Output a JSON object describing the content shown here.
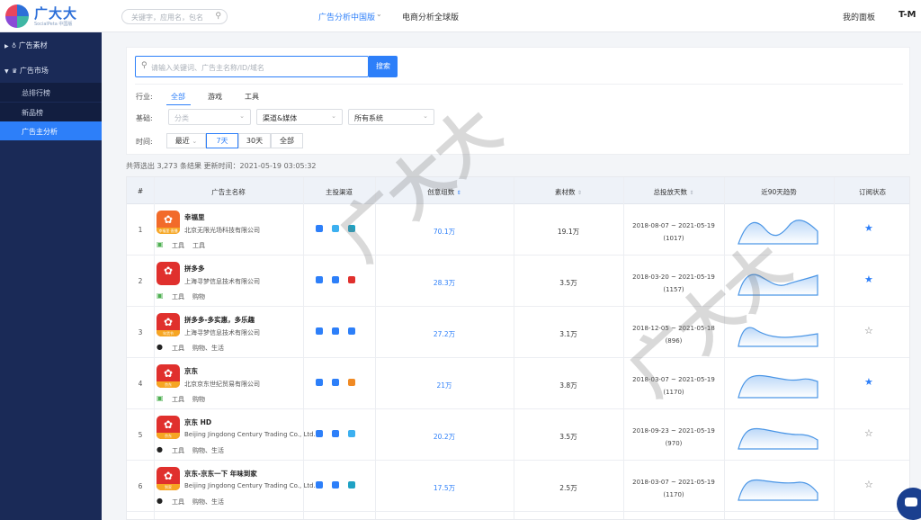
{
  "header": {
    "brand": "广大大",
    "brand_sub": "SocialPeta 中国版",
    "search_placeholder": "关键字，应用名，包名",
    "nav_primary": "广告分析中国版",
    "nav_secondary": "电商分析全球版",
    "my_panel": "我的面板",
    "user_logo": "T-M"
  },
  "sidebar": {
    "sections": [
      {
        "label": "广告素材"
      },
      {
        "label": "广告市场"
      }
    ],
    "subitems": [
      {
        "label": "总排行榜"
      },
      {
        "label": "新品榜"
      },
      {
        "label": "广告主分析",
        "active": true
      }
    ]
  },
  "search": {
    "placeholder": "请输入关键词、广告主名称/ID/域名",
    "button": "搜索"
  },
  "filters": {
    "industry_label": "行业:",
    "industry_options": [
      "全部",
      "游戏",
      "工具"
    ],
    "basic_label": "基础:",
    "category_placeholder": "分类",
    "channel_select": "渠道&媒体",
    "system_select": "所有系统",
    "time_label": "时间:",
    "time_options": [
      "最近",
      "7天",
      "30天",
      "全部"
    ]
  },
  "summary": "共筛选出 3,273 条结果 更新时间：2021-05-19 03:05:32",
  "table": {
    "headers": [
      "#",
      "广告主名称",
      "主投渠道",
      "创意组数",
      "素材数",
      "总投放天数",
      "近90天趋势",
      "订阅状态"
    ],
    "rows": [
      {
        "idx": "1",
        "name": "幸福里",
        "company": "北京无限光场科技有限公司",
        "platform": "android",
        "tags": [
          "工具",
          "工具"
        ],
        "creatives": "70.1万",
        "materials": "19.1万",
        "date_range": "2018-08-07 ~ 2021-05-19",
        "days": "(1017)",
        "subscribed": true,
        "icon": "orange",
        "ribbon": "幸福里·直播"
      },
      {
        "idx": "2",
        "name": "拼多多",
        "company": "上海寻梦信息技术有限公司",
        "platform": "android",
        "tags": [
          "工具",
          "购物"
        ],
        "creatives": "28.3万",
        "materials": "3.5万",
        "date_range": "2018-03-20 ~ 2021-05-19",
        "days": "(1157)",
        "subscribed": true,
        "icon": "red",
        "ribbon": ""
      },
      {
        "idx": "3",
        "name": "拼多多-多实惠，多乐趣",
        "company": "上海寻梦信息技术有限公司",
        "platform": "ios",
        "tags": [
          "工具",
          "购物、生活"
        ],
        "creatives": "27.2万",
        "materials": "3.1万",
        "date_range": "2018-12-05 ~ 2021-05-18",
        "days": "(896)",
        "subscribed": false,
        "icon": "red",
        "ribbon": "年货节"
      },
      {
        "idx": "4",
        "name": "京东",
        "company": "北京京东世纪贸易有限公司",
        "platform": "android",
        "tags": [
          "工具",
          "购物"
        ],
        "creatives": "21万",
        "materials": "3.8万",
        "date_range": "2018-03-07 ~ 2021-05-19",
        "days": "(1170)",
        "subscribed": true,
        "icon": "red",
        "ribbon": "京东"
      },
      {
        "idx": "5",
        "name": "京东 HD",
        "company": "Beijing Jingdong Century Trading Co., Ltd.",
        "platform": "ios",
        "tags": [
          "工具",
          "购物、生活"
        ],
        "creatives": "20.2万",
        "materials": "3.5万",
        "date_range": "2018-09-23 ~ 2021-05-19",
        "days": "(970)",
        "subscribed": false,
        "icon": "red",
        "ribbon": "京东"
      },
      {
        "idx": "6",
        "name": "京东-京东一下 年味到家",
        "company": "Beijing Jingdong Century Trading Co., Ltd.",
        "platform": "ios",
        "tags": [
          "工具",
          "购物、生活"
        ],
        "creatives": "17.5万",
        "materials": "2.5万",
        "date_range": "2018-03-07 ~ 2021-05-19",
        "days": "(1170)",
        "subscribed": false,
        "icon": "red",
        "ribbon": "到家"
      }
    ]
  },
  "watermark": "广大大",
  "colors": {
    "accent": "#2d7ff9",
    "sidebar": "#1a2a57"
  }
}
